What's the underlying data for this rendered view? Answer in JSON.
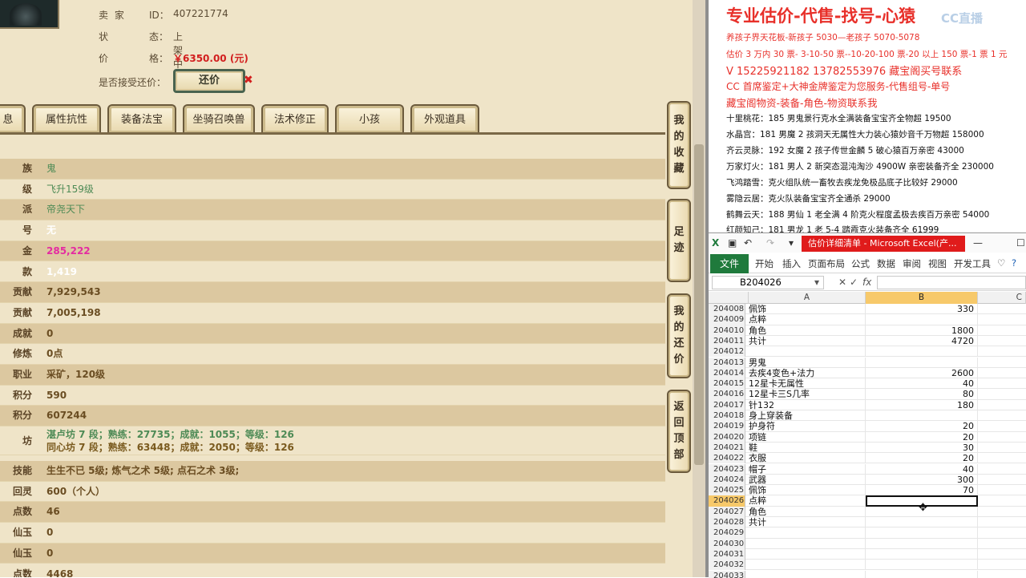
{
  "seller": {
    "seller_label": "卖 家",
    "id_label": "ID：",
    "id_value": "407221774",
    "status_label": "状",
    "status_label2": "态：",
    "status_value": "上架中",
    "price_label": "价",
    "price_label2": "格：",
    "price_value": "￥6350.00 (元)",
    "bargain_label": "是否接受还价：",
    "bargain_button": "还价"
  },
  "tabs": [
    "息",
    "属性抗性",
    "装备法宝",
    "坐骑召唤兽",
    "法术修正",
    "小孩",
    "外观道具"
  ],
  "attributes": [
    {
      "key": "族",
      "value": "鬼",
      "style": "green"
    },
    {
      "key": "级",
      "value": "飞升159级",
      "style": "green"
    },
    {
      "key": "派",
      "value": "帝尧天下",
      "style": "green"
    },
    {
      "key": "号",
      "value": "无",
      "style": "white"
    },
    {
      "key": "金",
      "value": "285,222",
      "style": "magenta"
    },
    {
      "key": "款",
      "value": "1,419",
      "style": "white"
    },
    {
      "key": "贡献",
      "value": "7,929,543",
      "style": ""
    },
    {
      "key": "贡献",
      "value": "7,005,198",
      "style": ""
    },
    {
      "key": "成就",
      "value": "0",
      "style": ""
    },
    {
      "key": "修炼",
      "value": "0点",
      "style": ""
    },
    {
      "key": "职业",
      "value": "采矿，120级",
      "style": ""
    },
    {
      "key": "积分",
      "value": "590",
      "style": ""
    },
    {
      "key": "积分",
      "value": "607244",
      "style": ""
    }
  ],
  "workshops": {
    "key": "坊",
    "line1": "湛卢坊 7 段；熟练：27735；成就：1055；等级：126",
    "line2": "同心坊 7 段；熟练：63448；成就：2050；等级：126"
  },
  "attributes2": [
    {
      "key": "技能",
      "value": "生生不已 5级; 炼气之术 5级; 点石之术 3级;",
      "style": ""
    },
    {
      "key": "回灵",
      "value": "600（个人）",
      "style": ""
    },
    {
      "key": "点数",
      "value": "46",
      "style": ""
    },
    {
      "key": "仙玉",
      "value": "0",
      "style": ""
    },
    {
      "key": "仙玉",
      "value": "0",
      "style": ""
    },
    {
      "key": "点数",
      "value": "4468",
      "style": ""
    }
  ],
  "side_buttons": [
    "我的收藏",
    "足迹",
    "我的还价",
    "返回顶部"
  ],
  "ad": {
    "title": "专业估价-代售-找号-心猿",
    "watermark": "CC直播",
    "lines": [
      {
        "text": "养孩子界天花板-新孩子 5030—老孩子 5070-5078",
        "color": "red"
      },
      {
        "text": "估价 3 万内 30 票- 3-10-50 票--10-20-100 票-20 以上 150 票-1 票 1 元",
        "color": "red"
      },
      {
        "text": "V 15225921182      13782553976    藏宝阁买号联系",
        "color": "red"
      },
      {
        "text": "CC 首席鉴定+大神金牌鉴定为您服务-代售组号-单号",
        "color": "red"
      },
      {
        "text": "藏宝阁物资-装备-角色-物资联系我",
        "color": "red"
      },
      {
        "text": "十里桃花：185 男鬼景行克水全满装备宝宝齐全物超 19500",
        "color": "black"
      },
      {
        "text": "水晶宫：181 男魔 2 孩洞天无属性大力装心猿妙音千万物超 158000",
        "color": "black"
      },
      {
        "text": "齐云灵脉：192 女魔 2 孩子传世金麟 5 破心猿百万亲密 43000",
        "color": "black"
      },
      {
        "text": "万家灯火：181 男人 2 新突态混沌淘沙 4900W 亲密装备齐全 230000",
        "color": "black"
      },
      {
        "text": "飞鸿踏雪：克火组队统一畜牧去疾龙免极品底子比较好 29000",
        "color": "black"
      },
      {
        "text": "雾隐云居：克火队装备宝宝齐全通杀 29000",
        "color": "black"
      },
      {
        "text": "鹤舞云天：188 男仙 1 老全满 4 阶克火程度孟极去疾百万亲密 54000",
        "color": "black"
      },
      {
        "text": "红颜知己：181 男龙 1 老 5-4 踏霞克火装备齐全 61999",
        "color": "black"
      }
    ]
  },
  "excel": {
    "window_title": "估价详细清单 - Microsoft Excel(产...",
    "file_tab": "文件",
    "ribbon_tabs": [
      "开始",
      "插入",
      "页面布局",
      "公式",
      "数据",
      "审阅",
      "视图",
      "开发工具"
    ],
    "name_box": "B204026",
    "fx_label": "fx",
    "columns": [
      "A",
      "B",
      "C"
    ],
    "rows": [
      {
        "n": "204008",
        "a": "佩饰",
        "b": "330"
      },
      {
        "n": "204009",
        "a": "点粹",
        "b": ""
      },
      {
        "n": "204010",
        "a": "角色",
        "b": "1800"
      },
      {
        "n": "204011",
        "a": "共计",
        "b": "4720"
      },
      {
        "n": "204012",
        "a": "",
        "b": ""
      },
      {
        "n": "204013",
        "a": "男鬼",
        "b": ""
      },
      {
        "n": "204014",
        "a": "去疾4变色+法力",
        "b": "2600"
      },
      {
        "n": "204015",
        "a": "12星卡无属性",
        "b": "40"
      },
      {
        "n": "204016",
        "a": "12星卡三S几率",
        "b": "80"
      },
      {
        "n": "204017",
        "a": "针132",
        "b": "180"
      },
      {
        "n": "204018",
        "a": "身上穿装备",
        "b": ""
      },
      {
        "n": "204019",
        "a": "护身符",
        "b": "20"
      },
      {
        "n": "204020",
        "a": "项链",
        "b": "20"
      },
      {
        "n": "204021",
        "a": "鞋",
        "b": "30"
      },
      {
        "n": "204022",
        "a": "衣服",
        "b": "20"
      },
      {
        "n": "204023",
        "a": "帽子",
        "b": "40"
      },
      {
        "n": "204024",
        "a": "武器",
        "b": "300"
      },
      {
        "n": "204025",
        "a": "佩饰",
        "b": "70"
      },
      {
        "n": "204026",
        "a": "点粹",
        "b": ""
      },
      {
        "n": "204027",
        "a": "角色",
        "b": ""
      },
      {
        "n": "204028",
        "a": "共计",
        "b": ""
      },
      {
        "n": "204029",
        "a": "",
        "b": ""
      },
      {
        "n": "204030",
        "a": "",
        "b": ""
      },
      {
        "n": "204031",
        "a": "",
        "b": ""
      },
      {
        "n": "204032",
        "a": "",
        "b": ""
      },
      {
        "n": "204033",
        "a": "",
        "b": ""
      }
    ],
    "selected_row": "204026"
  }
}
